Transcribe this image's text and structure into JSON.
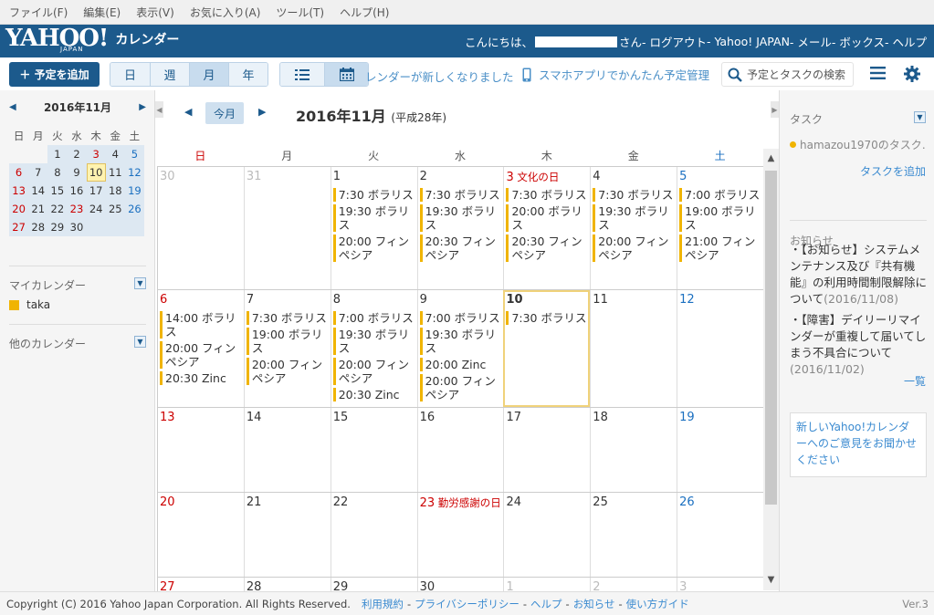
{
  "menu": [
    "ファイル(F)",
    "編集(E)",
    "表示(V)",
    "お気に入り(A)",
    "ツール(T)",
    "ヘルプ(H)"
  ],
  "header": {
    "logo": "YAHOO!",
    "logo_sub": "JAPAN",
    "app": "カレンダー",
    "greeting_pre": "こんにちは、",
    "greeting_post": "さん",
    "links": [
      " - ログアウト",
      " - Yahoo! JAPAN",
      " - メール",
      " - ボックス",
      " - ヘルプ"
    ]
  },
  "toolbar": {
    "add_label": "＋ 予定を追加",
    "views": [
      "日",
      "週",
      "月",
      "年"
    ],
    "notice": "レンダーが新しくなりました",
    "phone_link": "スマホアプリでかんたん予定管理",
    "search_placeholder": "予定とタスクの検索"
  },
  "mini": {
    "title": "2016年11月",
    "dow": [
      "日",
      "月",
      "火",
      "水",
      "木",
      "金",
      "土"
    ],
    "weeks": [
      [
        "",
        "",
        "1",
        "2",
        "3",
        "4",
        "5"
      ],
      [
        "6",
        "7",
        "8",
        "9",
        "10",
        "11",
        "12"
      ],
      [
        "13",
        "14",
        "15",
        "16",
        "17",
        "18",
        "19"
      ],
      [
        "20",
        "21",
        "22",
        "23",
        "24",
        "25",
        "26"
      ],
      [
        "27",
        "28",
        "29",
        "30",
        "",
        "",
        ""
      ]
    ],
    "today": "10"
  },
  "sidebar": {
    "my_cal": "マイカレンダー",
    "my_cal_item": "taka",
    "other_cal": "他のカレンダー"
  },
  "main": {
    "today_btn": "今月",
    "title": "2016年11月",
    "era": "(平成28年)",
    "dow": [
      "日",
      "月",
      "火",
      "水",
      "木",
      "金",
      "土"
    ],
    "weeks": [
      {
        "h": 135,
        "days": [
          {
            "n": "30",
            "c": "out"
          },
          {
            "n": "31",
            "c": "out"
          },
          {
            "n": "1",
            "ev": [
              "7:30 ボラリス",
              "19:30 ボラリス",
              "20:00 フィンペシア"
            ]
          },
          {
            "n": "2",
            "ev": [
              "7:30 ボラリス",
              "19:30 ボラリス",
              "20:30 フィンペシア"
            ]
          },
          {
            "n": "3",
            "hol": "文化の日",
            "c": "hol",
            "ev": [
              "7:30 ボラリス",
              "20:00 ボラリス",
              "20:30 フィンペシア"
            ]
          },
          {
            "n": "4",
            "ev": [
              "7:30 ボラリス",
              "19:30 ボラリス",
              "20:00 フィンペシア"
            ]
          },
          {
            "n": "5",
            "c": "sat",
            "ev": [
              "7:00 ボラリス",
              "19:00 ボラリス",
              "21:00 フィンペシア"
            ]
          }
        ]
      },
      {
        "h": 129,
        "days": [
          {
            "n": "6",
            "c": "sun",
            "ev": [
              "14:00 ボラリス",
              "20:00 フィンペシア",
              "20:30 Zinc"
            ]
          },
          {
            "n": "7",
            "ev": [
              "7:30 ボラリス",
              "19:00 ボラリス",
              "20:00 フィンペシア"
            ]
          },
          {
            "n": "8",
            "ev": [
              "7:00 ボラリス",
              "19:30 ボラリス",
              "20:00 フィンペシア",
              "20:30 Zinc"
            ]
          },
          {
            "n": "9",
            "ev": [
              "7:00 ボラリス",
              "19:30 ボラリス",
              "20:00 Zinc",
              "20:00 フィンペシア"
            ]
          },
          {
            "n": "10",
            "c": "tod",
            "ev": [
              "7:30 ボラリス"
            ]
          },
          {
            "n": "11"
          },
          {
            "n": "12",
            "c": "sat"
          }
        ]
      },
      {
        "h": 93,
        "days": [
          {
            "n": "13",
            "c": "sun"
          },
          {
            "n": "14"
          },
          {
            "n": "15"
          },
          {
            "n": "16"
          },
          {
            "n": "17"
          },
          {
            "n": "18"
          },
          {
            "n": "19",
            "c": "sat"
          }
        ]
      },
      {
        "h": 93,
        "days": [
          {
            "n": "20",
            "c": "sun"
          },
          {
            "n": "21"
          },
          {
            "n": "22"
          },
          {
            "n": "23",
            "hol": "勤労感謝の日",
            "c": "hol"
          },
          {
            "n": "24"
          },
          {
            "n": "25"
          },
          {
            "n": "26",
            "c": "sat"
          }
        ]
      },
      {
        "h": 40,
        "days": [
          {
            "n": "27",
            "c": "sun"
          },
          {
            "n": "28"
          },
          {
            "n": "29"
          },
          {
            "n": "30"
          },
          {
            "n": "1",
            "c": "out"
          },
          {
            "n": "2",
            "c": "out"
          },
          {
            "n": "3",
            "c": "out"
          }
        ]
      }
    ]
  },
  "right": {
    "task_h": "タスク",
    "task_item": "hamazou1970のタスク…",
    "task_add": "タスクを追加",
    "news_h": "お知らせ",
    "news1": "・【お知らせ】システムメンテナンス及び『共有機能』の利用時間制限解除について",
    "news1_date": "(2016/11/08)",
    "news2": "・【障害】デイリーリマインダーが重複して届いてしまう不具合について",
    "news2_date": "(2016/11/02)",
    "news_more": "一覧",
    "feedback": "新しいYahoo!カレンダーへのご意見をお聞かせください"
  },
  "footer": {
    "copyright": "Copyright (C) 2016 Yahoo Japan Corporation. All Rights Reserved.",
    "links": [
      "利用規約",
      "プライバシーポリシー",
      "ヘルプ",
      "お知らせ",
      "使い方ガイド"
    ],
    "version": "Ver.3"
  },
  "colors": {
    "header": "#1c5a8c",
    "event": "#f0b400",
    "link": "#3a8ad0"
  }
}
